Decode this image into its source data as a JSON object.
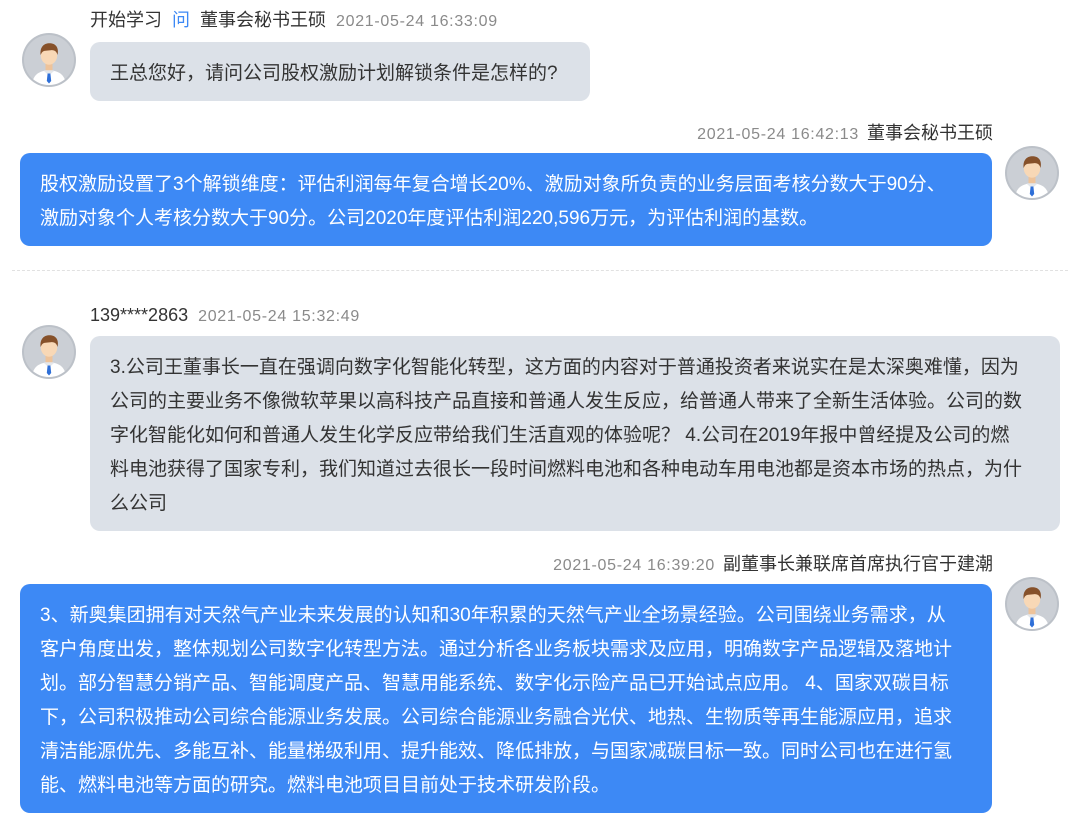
{
  "colors": {
    "accent": "#3d89f5",
    "question_bubble": "#dce1e8",
    "answer_bubble": "#3d89f5",
    "answer_text": "#ffffff",
    "meta_text": "#8a8a8a",
    "body_text": "#333333"
  },
  "icons": {
    "avatar": "user-avatar-icon"
  },
  "threads": [
    {
      "question": {
        "asker": "开始学习",
        "verb": "问",
        "addressee": "董事会秘书王硕",
        "time": "2021-05-24 16:33:09",
        "text": "王总您好，请问公司股权激励计划解锁条件是怎样的?"
      },
      "answer": {
        "time": "2021-05-24 16:42:13",
        "responder": "董事会秘书王硕",
        "text": "股权激励设置了3个解锁维度：评估利润每年复合增长20%、激励对象所负责的业务层面考核分数大于90分、激励对象个人考核分数大于90分。公司2020年度评估利润220,596万元，为评估利润的基数。"
      }
    },
    {
      "question": {
        "asker": "139****2863",
        "time": "2021-05-24 15:32:49",
        "text": "3.公司王董事长一直在强调向数字化智能化转型，这方面的内容对于普通投资者来说实在是太深奥难懂，因为公司的主要业务不像微软苹果以高科技产品直接和普通人发生反应，给普通人带来了全新生活体验。公司的数字化智能化如何和普通人发生化学反应带给我们生活直观的体验呢？ 4.公司在2019年报中曾经提及公司的燃料电池获得了国家专利，我们知道过去很长一段时间燃料电池和各种电动车用电池都是资本市场的热点，为什么公司"
      },
      "answer": {
        "time": "2021-05-24 16:39:20",
        "responder": "副董事长兼联席首席执行官于建潮",
        "text": "3、新奥集团拥有对天然气产业未来发展的认知和30年积累的天然气产业全场景经验。公司围绕业务需求，从客户角度出发，整体规划公司数字化转型方法。通过分析各业务板块需求及应用，明确数字产品逻辑及落地计划。部分智慧分销产品、智能调度产品、智慧用能系统、数字化示险产品已开始试点应用。 4、国家双碳目标下，公司积极推动公司综合能源业务发展。公司综合能源业务融合光伏、地热、生物质等再生能源应用，追求清洁能源优先、多能互补、能量梯级利用、提升能效、降低排放，与国家减碳目标一致。同时公司也在进行氢能、燃料电池等方面的研究。燃料电池项目目前处于技术研发阶段。"
      }
    }
  ]
}
